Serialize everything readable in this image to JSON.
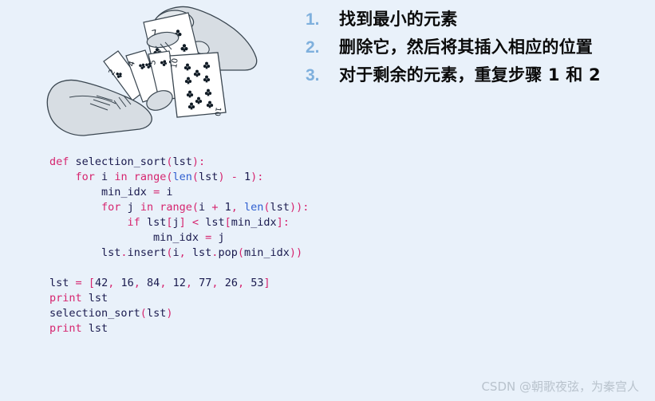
{
  "slide": {
    "background_color": "#e9f1fa"
  },
  "illustration": {
    "name": "hands-holding-playing-cards",
    "description": "Line drawing of two hands holding a fan of playing cards",
    "hand_fill": "#d7dde3",
    "outline_color": "#3a4650",
    "card_fill": "#ffffff",
    "pip_color": "#0f1a24",
    "cards": [
      {
        "rank": "2",
        "suit": "clubs"
      },
      {
        "rank": "4",
        "suit": "clubs"
      },
      {
        "rank": "5",
        "suit": "clubs"
      },
      {
        "rank": "7",
        "suit": "clubs"
      },
      {
        "rank": "10",
        "suit": "clubs"
      }
    ]
  },
  "steps": {
    "number_color": "#7fb0dd",
    "text_color": "#0b0b0b",
    "items": [
      {
        "number": "1.",
        "text": "找到最小的元素"
      },
      {
        "number": "2.",
        "text": "删除它，然后将其插入相应的位置"
      },
      {
        "number": "3.",
        "text": "对于剩余的元素，重复步骤 1 和 2"
      }
    ]
  },
  "code": {
    "language": "python",
    "keyword_color": "#d6256f",
    "builtin_color": "#2f5fd0",
    "identifier_color": "#1a1a4e",
    "lines": [
      {
        "indent": 0,
        "tokens": [
          {
            "t": "def",
            "c": "kw"
          },
          {
            "t": " ",
            "c": "plain"
          },
          {
            "t": "selection_sort",
            "c": "id"
          },
          {
            "t": "(",
            "c": "pun"
          },
          {
            "t": "lst",
            "c": "id"
          },
          {
            "t": ")",
            "c": "pun"
          },
          {
            "t": ":",
            "c": "pun"
          }
        ]
      },
      {
        "indent": 1,
        "tokens": [
          {
            "t": "for",
            "c": "kw"
          },
          {
            "t": " ",
            "c": "plain"
          },
          {
            "t": "i",
            "c": "id"
          },
          {
            "t": " ",
            "c": "plain"
          },
          {
            "t": "in",
            "c": "kw"
          },
          {
            "t": " ",
            "c": "plain"
          },
          {
            "t": "range",
            "c": "kw"
          },
          {
            "t": "(",
            "c": "pun"
          },
          {
            "t": "len",
            "c": "bi"
          },
          {
            "t": "(",
            "c": "pun"
          },
          {
            "t": "lst",
            "c": "id"
          },
          {
            "t": ")",
            "c": "pun"
          },
          {
            "t": " ",
            "c": "plain"
          },
          {
            "t": "-",
            "c": "pun"
          },
          {
            "t": " ",
            "c": "plain"
          },
          {
            "t": "1",
            "c": "num"
          },
          {
            "t": ")",
            "c": "pun"
          },
          {
            "t": ":",
            "c": "pun"
          }
        ]
      },
      {
        "indent": 2,
        "tokens": [
          {
            "t": "min_idx",
            "c": "id"
          },
          {
            "t": " ",
            "c": "plain"
          },
          {
            "t": "=",
            "c": "pun"
          },
          {
            "t": " ",
            "c": "plain"
          },
          {
            "t": "i",
            "c": "id"
          }
        ]
      },
      {
        "indent": 2,
        "tokens": [
          {
            "t": "for",
            "c": "kw"
          },
          {
            "t": " ",
            "c": "plain"
          },
          {
            "t": "j",
            "c": "id"
          },
          {
            "t": " ",
            "c": "plain"
          },
          {
            "t": "in",
            "c": "kw"
          },
          {
            "t": " ",
            "c": "plain"
          },
          {
            "t": "range",
            "c": "kw"
          },
          {
            "t": "(",
            "c": "pun"
          },
          {
            "t": "i",
            "c": "id"
          },
          {
            "t": " ",
            "c": "plain"
          },
          {
            "t": "+",
            "c": "pun"
          },
          {
            "t": " ",
            "c": "plain"
          },
          {
            "t": "1",
            "c": "num"
          },
          {
            "t": ",",
            "c": "pun"
          },
          {
            "t": " ",
            "c": "plain"
          },
          {
            "t": "len",
            "c": "bi"
          },
          {
            "t": "(",
            "c": "pun"
          },
          {
            "t": "lst",
            "c": "id"
          },
          {
            "t": ")",
            "c": "pun"
          },
          {
            "t": ")",
            "c": "pun"
          },
          {
            "t": ":",
            "c": "pun"
          }
        ]
      },
      {
        "indent": 3,
        "tokens": [
          {
            "t": "if",
            "c": "kw"
          },
          {
            "t": " ",
            "c": "plain"
          },
          {
            "t": "lst",
            "c": "id"
          },
          {
            "t": "[",
            "c": "pun"
          },
          {
            "t": "j",
            "c": "id"
          },
          {
            "t": "]",
            "c": "pun"
          },
          {
            "t": " ",
            "c": "plain"
          },
          {
            "t": "<",
            "c": "pun"
          },
          {
            "t": " ",
            "c": "plain"
          },
          {
            "t": "lst",
            "c": "id"
          },
          {
            "t": "[",
            "c": "pun"
          },
          {
            "t": "min_idx",
            "c": "id"
          },
          {
            "t": "]",
            "c": "pun"
          },
          {
            "t": ":",
            "c": "pun"
          }
        ]
      },
      {
        "indent": 4,
        "tokens": [
          {
            "t": "min_idx",
            "c": "id"
          },
          {
            "t": " ",
            "c": "plain"
          },
          {
            "t": "=",
            "c": "pun"
          },
          {
            "t": " ",
            "c": "plain"
          },
          {
            "t": "j",
            "c": "id"
          }
        ]
      },
      {
        "indent": 2,
        "tokens": [
          {
            "t": "lst",
            "c": "id"
          },
          {
            "t": ".",
            "c": "pun"
          },
          {
            "t": "insert",
            "c": "id"
          },
          {
            "t": "(",
            "c": "pun"
          },
          {
            "t": "i",
            "c": "id"
          },
          {
            "t": ",",
            "c": "pun"
          },
          {
            "t": " ",
            "c": "plain"
          },
          {
            "t": "lst",
            "c": "id"
          },
          {
            "t": ".",
            "c": "pun"
          },
          {
            "t": "pop",
            "c": "id"
          },
          {
            "t": "(",
            "c": "pun"
          },
          {
            "t": "min_idx",
            "c": "id"
          },
          {
            "t": ")",
            "c": "pun"
          },
          {
            "t": ")",
            "c": "pun"
          }
        ]
      },
      {
        "indent": 0,
        "tokens": []
      },
      {
        "indent": 0,
        "tokens": [
          {
            "t": "lst",
            "c": "id"
          },
          {
            "t": " ",
            "c": "plain"
          },
          {
            "t": "=",
            "c": "pun"
          },
          {
            "t": " ",
            "c": "plain"
          },
          {
            "t": "[",
            "c": "pun"
          },
          {
            "t": "42",
            "c": "num"
          },
          {
            "t": ",",
            "c": "pun"
          },
          {
            "t": " ",
            "c": "plain"
          },
          {
            "t": "16",
            "c": "num"
          },
          {
            "t": ",",
            "c": "pun"
          },
          {
            "t": " ",
            "c": "plain"
          },
          {
            "t": "84",
            "c": "num"
          },
          {
            "t": ",",
            "c": "pun"
          },
          {
            "t": " ",
            "c": "plain"
          },
          {
            "t": "12",
            "c": "num"
          },
          {
            "t": ",",
            "c": "pun"
          },
          {
            "t": " ",
            "c": "plain"
          },
          {
            "t": "77",
            "c": "num"
          },
          {
            "t": ",",
            "c": "pun"
          },
          {
            "t": " ",
            "c": "plain"
          },
          {
            "t": "26",
            "c": "num"
          },
          {
            "t": ",",
            "c": "pun"
          },
          {
            "t": " ",
            "c": "plain"
          },
          {
            "t": "53",
            "c": "num"
          },
          {
            "t": "]",
            "c": "pun"
          }
        ]
      },
      {
        "indent": 0,
        "tokens": [
          {
            "t": "print",
            "c": "kw"
          },
          {
            "t": " ",
            "c": "plain"
          },
          {
            "t": "lst",
            "c": "id"
          }
        ]
      },
      {
        "indent": 0,
        "tokens": [
          {
            "t": "selection_sort",
            "c": "id"
          },
          {
            "t": "(",
            "c": "pun"
          },
          {
            "t": "lst",
            "c": "id"
          },
          {
            "t": ")",
            "c": "pun"
          }
        ]
      },
      {
        "indent": 0,
        "tokens": [
          {
            "t": "print",
            "c": "kw"
          },
          {
            "t": " ",
            "c": "plain"
          },
          {
            "t": "lst",
            "c": "id"
          }
        ]
      }
    ],
    "list_values": [
      42,
      16,
      84,
      12,
      77,
      26,
      53
    ]
  },
  "watermark": {
    "text": "CSDN @朝歌夜弦，为秦宫人",
    "color": "#b9c3cd"
  }
}
